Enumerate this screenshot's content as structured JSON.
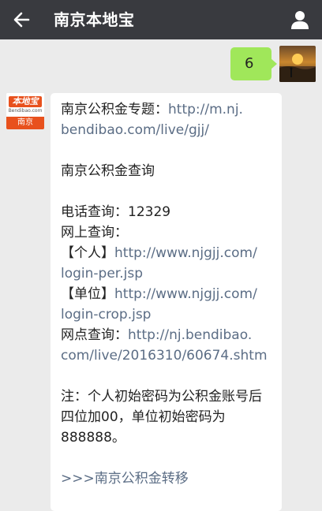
{
  "header": {
    "title": "南京本地宝",
    "back_icon": "back-arrow-icon",
    "profile_icon": "person-icon",
    "bg_color": "#393a3f"
  },
  "messages": {
    "outgoing": {
      "text": "6",
      "bubble_color": "#a0e75a"
    },
    "incoming": {
      "avatar": {
        "logo_text": "本地宝",
        "logo_sub": "Bendibao.com",
        "city": "南京"
      },
      "topic_label": "南京公积金专题：",
      "topic_link_1": "http://m.nj.",
      "topic_link_2": "bendibao.com/live/gjj/",
      "query_heading": "南京公积金查询",
      "phone_label": "电话查询：",
      "phone_number": "12329",
      "online_label": "网上查询：",
      "personal_label": "【个人】",
      "personal_link_1": "http://www.njgjj.com/",
      "personal_link_2": "login-per.jsp",
      "unit_label": "【单位】",
      "unit_link_1": "http://www.njgjj.com/",
      "unit_link_2": "login-crop.jsp",
      "branch_label": "网点查询：",
      "branch_link_1": "http://nj.bendibao.",
      "branch_link_2": "com/live/2016310/60674.shtm",
      "note_1": "注：个人初始密码为公积金账号后",
      "note_2": "四位加00，单位初始密码为",
      "note_3": "888888。",
      "transfer_prefix": ">>>",
      "transfer_link": "南京公积金转移",
      "link_color": "#5b6d85",
      "logo_color": "#e8511d"
    }
  }
}
